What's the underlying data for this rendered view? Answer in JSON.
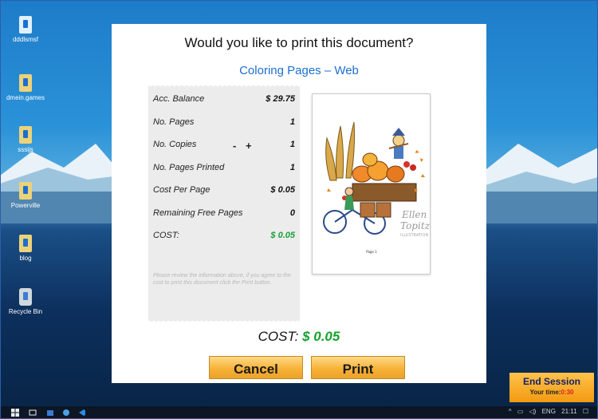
{
  "desktop": {
    "icons": [
      {
        "label": "dddlsmsf",
        "icon": "vscode-file-icon"
      },
      {
        "label": "dmein.games",
        "icon": "file-icon"
      },
      {
        "label": "sssijs",
        "icon": "file-icon"
      },
      {
        "label": "Powerville",
        "icon": "file-icon"
      },
      {
        "label": "blog",
        "icon": "file-icon"
      },
      {
        "label": "Recycle Bin",
        "icon": "recycle-bin-icon"
      }
    ]
  },
  "dialog": {
    "title": "Would you like to print this document?",
    "document_name": "Coloring Pages – Web",
    "rows": [
      {
        "label": "Acc. Balance",
        "value": "$ 29.75"
      },
      {
        "label": "No. Pages",
        "value": "1"
      },
      {
        "label": "No. Copies",
        "value": "1"
      },
      {
        "label": "No. Pages Printed",
        "value": "1"
      },
      {
        "label": "Cost Per Page",
        "value": "$ 0.05"
      },
      {
        "label": "Remaining Free Pages",
        "value": "0"
      },
      {
        "label": "COST:",
        "value": "$ 0.05"
      }
    ],
    "stepper": {
      "minus": "-",
      "plus": "+"
    },
    "note": "Please review the information above, if you agree to the cost to print this document click the Print button.",
    "preview": {
      "signature_line1": "Ellen",
      "signature_line2": "Topitzer",
      "signature_line3": "ILLUSTRATION",
      "page_label": "Page 1"
    },
    "cost_label": "COST:",
    "cost_value": "$ 0.05",
    "cancel_label": "Cancel",
    "print_label": "Print",
    "colors": {
      "accent_blue": "#1d6fd0",
      "cost_green": "#16a12f",
      "button_orange": "#f7b238"
    }
  },
  "end_session": {
    "label": "End Session",
    "time_label": "Your time:",
    "time_value": "0:30"
  },
  "taskbar": {
    "icons": [
      "windows-start-icon",
      "task-view-icon",
      "store-icon",
      "settings-icon",
      "vscode-icon"
    ],
    "tray": {
      "language": "ENG",
      "time": "21:11"
    }
  }
}
